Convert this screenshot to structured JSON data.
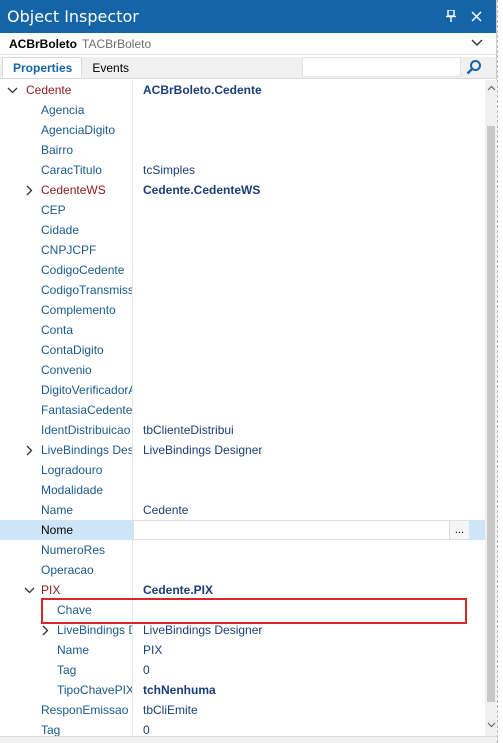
{
  "window": {
    "title": "Object Inspector"
  },
  "component": {
    "name": "ACBrBoleto",
    "class": "TACBrBoleto"
  },
  "tabs": [
    {
      "label": "Properties"
    },
    {
      "label": "Events"
    }
  ],
  "rows": [
    {
      "name": "Cedente",
      "value": "ACBrBoleto.Cedente",
      "indent": 0,
      "expander": "open",
      "kind": "ref",
      "bold": true
    },
    {
      "name": "Agencia",
      "value": "",
      "indent": 1,
      "expander": "",
      "kind": "prop",
      "bold": false
    },
    {
      "name": "AgenciaDigito",
      "value": "",
      "indent": 1,
      "expander": "",
      "kind": "prop",
      "bold": false
    },
    {
      "name": "Bairro",
      "value": "",
      "indent": 1,
      "expander": "",
      "kind": "prop",
      "bold": false
    },
    {
      "name": "CaracTitulo",
      "value": "tcSimples",
      "indent": 1,
      "expander": "",
      "kind": "prop",
      "bold": false
    },
    {
      "name": "CedenteWS",
      "value": "Cedente.CedenteWS",
      "indent": 1,
      "expander": "closed",
      "kind": "ref",
      "bold": true
    },
    {
      "name": "CEP",
      "value": "",
      "indent": 1,
      "expander": "",
      "kind": "prop",
      "bold": false
    },
    {
      "name": "Cidade",
      "value": "",
      "indent": 1,
      "expander": "",
      "kind": "prop",
      "bold": false
    },
    {
      "name": "CNPJCPF",
      "value": "",
      "indent": 1,
      "expander": "",
      "kind": "prop",
      "bold": false
    },
    {
      "name": "CodigoCedente",
      "value": "",
      "indent": 1,
      "expander": "",
      "kind": "prop",
      "bold": false
    },
    {
      "name": "CodigoTransmiss",
      "value": "",
      "indent": 1,
      "expander": "",
      "kind": "prop",
      "bold": false
    },
    {
      "name": "Complemento",
      "value": "",
      "indent": 1,
      "expander": "",
      "kind": "prop",
      "bold": false
    },
    {
      "name": "Conta",
      "value": "",
      "indent": 1,
      "expander": "",
      "kind": "prop",
      "bold": false
    },
    {
      "name": "ContaDigito",
      "value": "",
      "indent": 1,
      "expander": "",
      "kind": "prop",
      "bold": false
    },
    {
      "name": "Convenio",
      "value": "",
      "indent": 1,
      "expander": "",
      "kind": "prop",
      "bold": false
    },
    {
      "name": "DigitoVerificadorA",
      "value": "",
      "indent": 1,
      "expander": "",
      "kind": "prop",
      "bold": false
    },
    {
      "name": "FantasiaCedente",
      "value": "",
      "indent": 1,
      "expander": "",
      "kind": "prop",
      "bold": false
    },
    {
      "name": "IdentDistribuicao",
      "value": "tbClienteDistribui",
      "indent": 1,
      "expander": "",
      "kind": "prop",
      "bold": false
    },
    {
      "name": "LiveBindings Des",
      "value": "LiveBindings Designer",
      "indent": 1,
      "expander": "closed",
      "kind": "prop",
      "bold": false
    },
    {
      "name": "Logradouro",
      "value": "",
      "indent": 1,
      "expander": "",
      "kind": "prop",
      "bold": false
    },
    {
      "name": "Modalidade",
      "value": "",
      "indent": 1,
      "expander": "",
      "kind": "prop",
      "bold": false
    },
    {
      "name": "Name",
      "value": "Cedente",
      "indent": 1,
      "expander": "",
      "kind": "prop",
      "bold": false
    },
    {
      "name": "Nome",
      "value": "",
      "indent": 1,
      "expander": "",
      "kind": "prop",
      "bold": false,
      "selected": true,
      "ellipsis": "..."
    },
    {
      "name": "NumeroRes",
      "value": "",
      "indent": 1,
      "expander": "",
      "kind": "prop",
      "bold": false
    },
    {
      "name": "Operacao",
      "value": "",
      "indent": 1,
      "expander": "",
      "kind": "prop",
      "bold": false
    },
    {
      "name": "PIX",
      "value": "Cedente.PIX",
      "indent": 1,
      "expander": "open",
      "kind": "ref",
      "bold": true
    },
    {
      "name": "Chave",
      "value": "",
      "indent": 2,
      "expander": "",
      "kind": "prop",
      "bold": false
    },
    {
      "name": "LiveBindings D",
      "value": "LiveBindings Designer",
      "indent": 2,
      "expander": "closed",
      "kind": "prop",
      "bold": false
    },
    {
      "name": "Name",
      "value": "PIX",
      "indent": 2,
      "expander": "",
      "kind": "prop",
      "bold": false
    },
    {
      "name": "Tag",
      "value": "0",
      "indent": 2,
      "expander": "",
      "kind": "prop",
      "bold": false
    },
    {
      "name": "TipoChavePIX",
      "value": "tchNenhuma",
      "indent": 2,
      "expander": "",
      "kind": "prop",
      "bold": true
    },
    {
      "name": "ResponEmissao",
      "value": "tbCliEmite",
      "indent": 1,
      "expander": "",
      "kind": "prop",
      "bold": false
    },
    {
      "name": "Tag",
      "value": "0",
      "indent": 1,
      "expander": "",
      "kind": "prop",
      "bold": false
    }
  ]
}
